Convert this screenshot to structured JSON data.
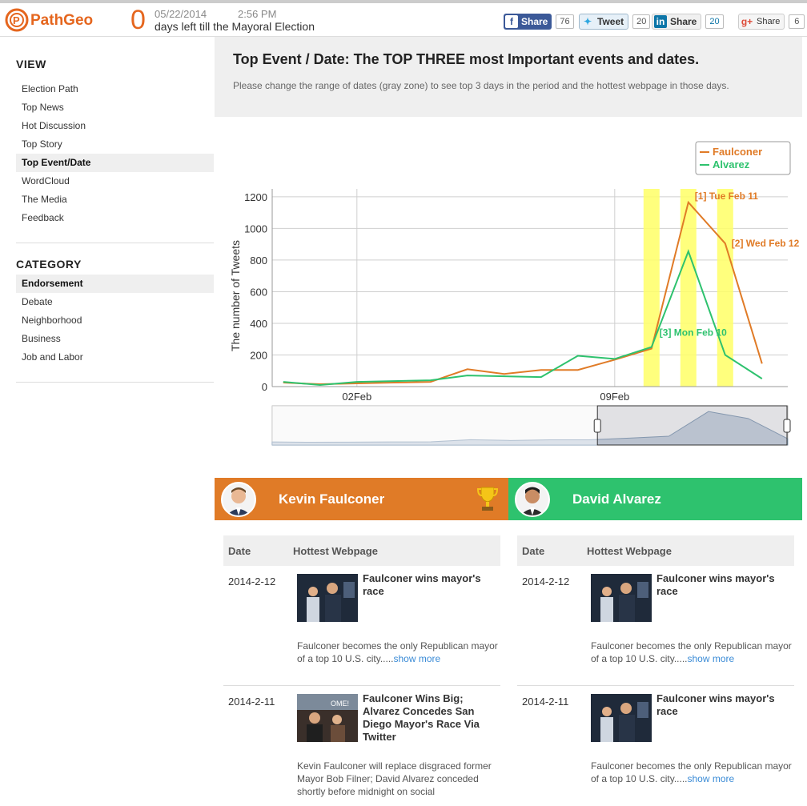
{
  "header": {
    "logo_text": "PathGeo",
    "days_left": "0",
    "date": "05/22/2014",
    "time": "2:56 PM",
    "days_text": "days left till the Mayoral Election",
    "shares": [
      {
        "label": "Share",
        "count": "76",
        "color": "#3b5998",
        "icon": "f"
      },
      {
        "label": "Tweet",
        "count": "20",
        "color": "#e8f1f8",
        "icon": "t"
      },
      {
        "label": "Share",
        "count": "20",
        "color": "#f0f0f0",
        "icon": "in"
      },
      {
        "label": "Share",
        "count": "6",
        "color": "#f5f5f5",
        "icon": "g+"
      }
    ]
  },
  "sidebar": {
    "view_title": "VIEW",
    "view_items": [
      "Election Path",
      "Top News",
      "Hot Discussion",
      "Top Story",
      "Top Event/Date",
      "WordCloud",
      "The Media",
      "Feedback"
    ],
    "view_active": "Top Event/Date",
    "category_title": "CATEGORY",
    "category_items": [
      "Endorsement",
      "Debate",
      "Neighborhood",
      "Business",
      "Job and Labor"
    ],
    "category_active": "Endorsement"
  },
  "banner": {
    "title": "Top Event / Date: The TOP THREE most Important events and dates.",
    "subtitle": "Please change the range of dates (gray zone) to see top 3 days in the period and the hottest webpage in those days."
  },
  "chart_data": {
    "type": "line",
    "ylabel": "The number of Tweets",
    "xlabel": "",
    "ylim": [
      0,
      1250
    ],
    "yticks": [
      0,
      200,
      400,
      600,
      800,
      1000,
      1200
    ],
    "xtick_labels": [
      "02Feb",
      "09Feb"
    ],
    "x": [
      "2014-01-31",
      "2014-02-01",
      "2014-02-02",
      "2014-02-03",
      "2014-02-04",
      "2014-02-05",
      "2014-02-06",
      "2014-02-07",
      "2014-02-08",
      "2014-02-09",
      "2014-02-10",
      "2014-02-11",
      "2014-02-12",
      "2014-02-13"
    ],
    "series": [
      {
        "name": "Faulconer",
        "color": "#e07b27",
        "values": [
          25,
          15,
          20,
          25,
          30,
          110,
          80,
          105,
          105,
          170,
          240,
          1165,
          905,
          145
        ]
      },
      {
        "name": "Alvarez",
        "color": "#2ec26e",
        "values": [
          30,
          10,
          30,
          35,
          40,
          70,
          65,
          60,
          195,
          175,
          250,
          855,
          200,
          50
        ]
      }
    ],
    "highlights": [
      {
        "label": "[1] Tue Feb 11",
        "date": "2014-02-11",
        "color": "#e07b27"
      },
      {
        "label": "[2] Wed Feb 12",
        "date": "2014-02-12",
        "color": "#e07b27"
      },
      {
        "label": "[3] Mon Feb 10",
        "date": "2014-02-10",
        "color": "#2ec26e"
      }
    ],
    "legend_position": "top-right",
    "navigator": {
      "selected_from": "2014-02-08",
      "selected_to": "2014-02-13"
    }
  },
  "candidates": [
    {
      "name": "Kevin Faulconer",
      "color": "#e07b27",
      "winner": true
    },
    {
      "name": "David Alvarez",
      "color": "#2ec26e",
      "winner": false
    }
  ],
  "tables": [
    {
      "col_date": "Date",
      "col_page": "Hottest Webpage",
      "rows": [
        {
          "date": "2014-2-12",
          "title": "Faulconer wins mayor's race",
          "desc": "Faulconer becomes the only Republican mayor of a top 10 U.S. city.....",
          "more": "show more"
        },
        {
          "date": "2014-2-11",
          "title": "Faulconer Wins Big; Alvarez Concedes San Diego Mayor's Race Via Twitter",
          "desc": "Kevin Faulconer will replace disgraced former Mayor Bob Filner; David Alvarez conceded shortly before midnight on social",
          "more": ""
        }
      ]
    },
    {
      "col_date": "Date",
      "col_page": "Hottest Webpage",
      "rows": [
        {
          "date": "2014-2-12",
          "title": "Faulconer wins mayor's race",
          "desc": "Faulconer becomes the only Republican mayor of a top 10 U.S. city.....",
          "more": "show more"
        },
        {
          "date": "2014-2-11",
          "title": "Faulconer wins mayor's race",
          "desc": "Faulconer becomes the only Republican mayor of a top 10 U.S. city.....",
          "more": "show more"
        }
      ]
    }
  ]
}
